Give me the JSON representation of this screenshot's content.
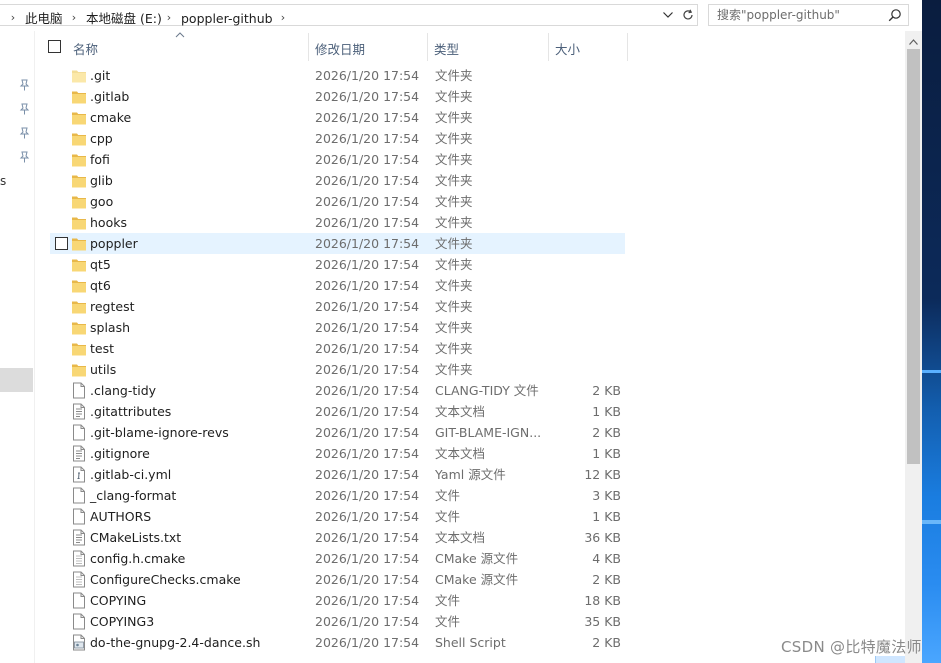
{
  "address": {
    "crumbs": [
      "此电脑",
      "本地磁盘 (E:)",
      "poppler-github"
    ]
  },
  "search": {
    "placeholder": "搜索\"poppler-github\""
  },
  "nav": {
    "fragment": "s"
  },
  "columns": {
    "name": "名称",
    "date": "修改日期",
    "type": "类型",
    "size": "大小"
  },
  "files": [
    {
      "name": ".git",
      "date": "2026/1/20 17:54",
      "type": "文件夹",
      "size": "",
      "icon": "folder-icon-light"
    },
    {
      "name": ".gitlab",
      "date": "2026/1/20 17:54",
      "type": "文件夹",
      "size": "",
      "icon": "folder-icon"
    },
    {
      "name": "cmake",
      "date": "2026/1/20 17:54",
      "type": "文件夹",
      "size": "",
      "icon": "folder-icon"
    },
    {
      "name": "cpp",
      "date": "2026/1/20 17:54",
      "type": "文件夹",
      "size": "",
      "icon": "folder-icon"
    },
    {
      "name": "fofi",
      "date": "2026/1/20 17:54",
      "type": "文件夹",
      "size": "",
      "icon": "folder-icon"
    },
    {
      "name": "glib",
      "date": "2026/1/20 17:54",
      "type": "文件夹",
      "size": "",
      "icon": "folder-icon"
    },
    {
      "name": "goo",
      "date": "2026/1/20 17:54",
      "type": "文件夹",
      "size": "",
      "icon": "folder-icon"
    },
    {
      "name": "hooks",
      "date": "2026/1/20 17:54",
      "type": "文件夹",
      "size": "",
      "icon": "folder-icon"
    },
    {
      "name": "poppler",
      "date": "2026/1/20 17:54",
      "type": "文件夹",
      "size": "",
      "icon": "folder-icon",
      "hover": true
    },
    {
      "name": "qt5",
      "date": "2026/1/20 17:54",
      "type": "文件夹",
      "size": "",
      "icon": "folder-icon"
    },
    {
      "name": "qt6",
      "date": "2026/1/20 17:54",
      "type": "文件夹",
      "size": "",
      "icon": "folder-icon"
    },
    {
      "name": "regtest",
      "date": "2026/1/20 17:54",
      "type": "文件夹",
      "size": "",
      "icon": "folder-icon"
    },
    {
      "name": "splash",
      "date": "2026/1/20 17:54",
      "type": "文件夹",
      "size": "",
      "icon": "folder-icon"
    },
    {
      "name": "test",
      "date": "2026/1/20 17:54",
      "type": "文件夹",
      "size": "",
      "icon": "folder-icon"
    },
    {
      "name": "utils",
      "date": "2026/1/20 17:54",
      "type": "文件夹",
      "size": "",
      "icon": "folder-icon"
    },
    {
      "name": ".clang-tidy",
      "date": "2026/1/20 17:54",
      "type": "CLANG-TIDY 文件",
      "size": "2 KB",
      "icon": "file-icon"
    },
    {
      "name": ".gitattributes",
      "date": "2026/1/20 17:54",
      "type": "文本文档",
      "size": "1 KB",
      "icon": "text-file-icon"
    },
    {
      "name": ".git-blame-ignore-revs",
      "date": "2026/1/20 17:54",
      "type": "GIT-BLAME-IGN...",
      "size": "2 KB",
      "icon": "file-icon"
    },
    {
      "name": ".gitignore",
      "date": "2026/1/20 17:54",
      "type": "文本文档",
      "size": "1 KB",
      "icon": "text-file-icon"
    },
    {
      "name": ".gitlab-ci.yml",
      "date": "2026/1/20 17:54",
      "type": "Yaml 源文件",
      "size": "12 KB",
      "icon": "yaml-file-icon"
    },
    {
      "name": "_clang-format",
      "date": "2026/1/20 17:54",
      "type": "文件",
      "size": "3 KB",
      "icon": "file-icon"
    },
    {
      "name": "AUTHORS",
      "date": "2026/1/20 17:54",
      "type": "文件",
      "size": "1 KB",
      "icon": "file-icon"
    },
    {
      "name": "CMakeLists.txt",
      "date": "2026/1/20 17:54",
      "type": "文本文档",
      "size": "36 KB",
      "icon": "text-file-icon"
    },
    {
      "name": "config.h.cmake",
      "date": "2026/1/20 17:54",
      "type": "CMake 源文件",
      "size": "4 KB",
      "icon": "cmake-file-icon"
    },
    {
      "name": "ConfigureChecks.cmake",
      "date": "2026/1/20 17:54",
      "type": "CMake 源文件",
      "size": "2 KB",
      "icon": "cmake-file-icon"
    },
    {
      "name": "COPYING",
      "date": "2026/1/20 17:54",
      "type": "文件",
      "size": "18 KB",
      "icon": "file-icon"
    },
    {
      "name": "COPYING3",
      "date": "2026/1/20 17:54",
      "type": "文件",
      "size": "35 KB",
      "icon": "file-icon"
    },
    {
      "name": "do-the-gnupg-2.4-dance.sh",
      "date": "2026/1/20 17:54",
      "type": "Shell Script",
      "size": "2 KB",
      "icon": "script-file-icon"
    }
  ],
  "watermark": "CSDN @比特魔法师"
}
